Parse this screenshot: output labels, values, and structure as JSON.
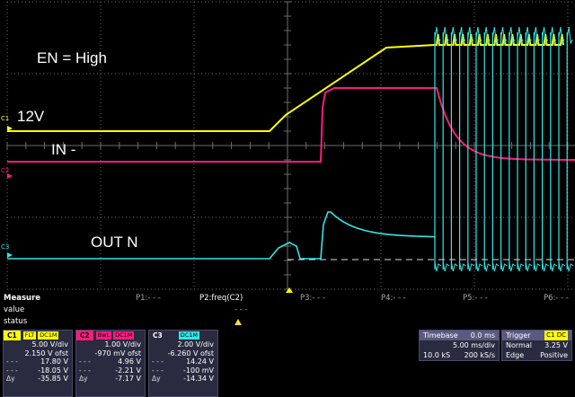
{
  "annotations": {
    "en_high": "EN = High",
    "v12": "12V",
    "in_minus": "IN -",
    "out_n": "OUT N"
  },
  "channel_markers": {
    "c1": "C1",
    "c2": "C2",
    "c3": "C3"
  },
  "colors": {
    "c1": "#ffff00",
    "c2": "#ff1a7f",
    "c3": "#33e6e6",
    "grid": "#6e6e6e",
    "panel": "#2a2a40"
  },
  "measure": {
    "title": "Measure",
    "row_value": "value",
    "row_status": "status",
    "slots": [
      "P1:- - -",
      "P2:freq(C2)",
      "P3:- - -",
      "P4:- - -",
      "P5:- - -",
      "P6:- - -"
    ],
    "p2_value": "- - -",
    "status_icon": "warning-icon"
  },
  "channels": [
    {
      "tag": "C1",
      "flags": [
        "FLT",
        "DC1M"
      ],
      "scale": "5.00 V/div",
      "offset": "2.150 V ofst",
      "cursor1_label": "- - -",
      "cursor1": "17.80 V",
      "cursor2_label": "- - -",
      "cursor2": "-18.05 V",
      "delta_label": "Δy",
      "delta": "-35.85 V"
    },
    {
      "tag": "C2",
      "flags": [
        "BwL",
        "DC1M"
      ],
      "scale": "1.00 V/div",
      "offset": "-970 mV ofst",
      "cursor1_label": "- - -",
      "cursor1": "4.96 V",
      "cursor2_label": "- - -",
      "cursor2": "-2.21 V",
      "delta_label": "Δy",
      "delta": "-7.17 V"
    },
    {
      "tag": "C3",
      "flags": [
        "DC1M"
      ],
      "scale": "2.00 V/div",
      "offset": "-6.260 V ofst",
      "cursor1_label": "- - -",
      "cursor1": "14.24 V",
      "cursor2_label": "- - -",
      "cursor2": "-100 mV",
      "delta_label": "Δy",
      "delta": "-14.34 V"
    }
  ],
  "timebase": {
    "label": "Timebase",
    "delay": "0.0 ms",
    "per_div": "5.00 ms/div",
    "samples": "10.0 kS",
    "rate": "200 kS/s"
  },
  "trigger": {
    "label": "Trigger",
    "source": "C1 DC",
    "mode": "Normal",
    "level": "3.25 V",
    "type": "Edge",
    "slope": "Positive"
  }
}
